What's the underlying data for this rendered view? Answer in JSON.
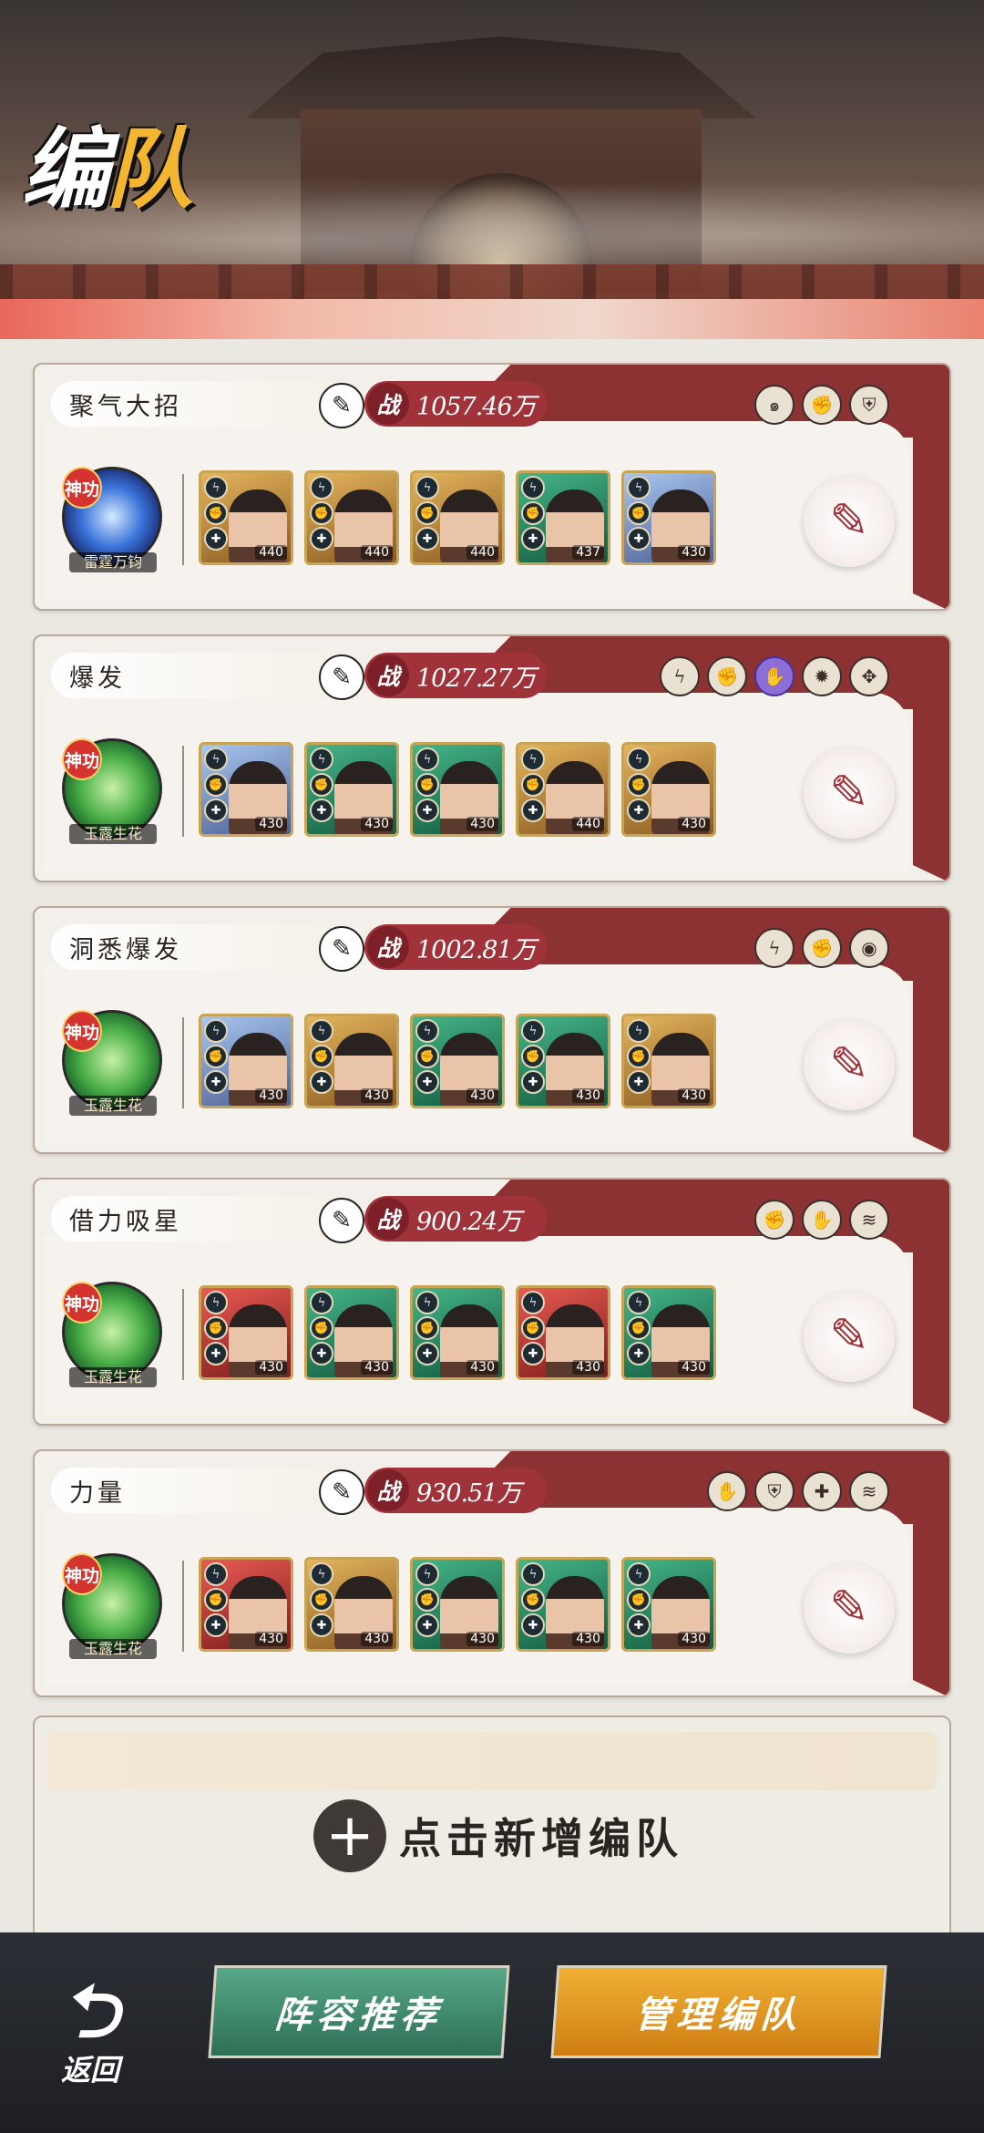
{
  "header": {
    "title_main": "编",
    "title_accent": "队"
  },
  "teams": [
    {
      "name": "聚气大招",
      "power": "1057.46万",
      "power_label": "战",
      "traits": [
        "swirl-icon",
        "fist-icon",
        "shield-icon"
      ],
      "skill": {
        "tag": "神功",
        "name": "雷霆万钧",
        "style": "thunder"
      },
      "heroes": [
        {
          "level": "440",
          "bg": "gold"
        },
        {
          "level": "440",
          "bg": "gold"
        },
        {
          "level": "440",
          "bg": "gold"
        },
        {
          "level": "437",
          "bg": "green"
        },
        {
          "level": "430",
          "bg": "blue"
        }
      ]
    },
    {
      "name": "爆发",
      "power": "1027.27万",
      "power_label": "战",
      "traits": [
        "lightning-icon",
        "fist-icon",
        "purple-hand-icon",
        "flame-icon",
        "paw-icon"
      ],
      "skill": {
        "tag": "神功",
        "name": "玉露生花",
        "style": "lotus"
      },
      "heroes": [
        {
          "level": "430",
          "bg": "blue"
        },
        {
          "level": "430",
          "bg": "green"
        },
        {
          "level": "430",
          "bg": "green"
        },
        {
          "level": "440",
          "bg": "gold"
        },
        {
          "level": "430",
          "bg": "gold"
        }
      ]
    },
    {
      "name": "洞悉爆发",
      "power": "1002.81万",
      "power_label": "战",
      "traits": [
        "lightning-icon",
        "fist-icon",
        "eye-icon"
      ],
      "skill": {
        "tag": "神功",
        "name": "玉露生花",
        "style": "lotus"
      },
      "heroes": [
        {
          "level": "430",
          "bg": "blue"
        },
        {
          "level": "430",
          "bg": "gold"
        },
        {
          "level": "430",
          "bg": "green"
        },
        {
          "level": "430",
          "bg": "green"
        },
        {
          "level": "430",
          "bg": "gold"
        }
      ]
    },
    {
      "name": "借力吸星",
      "power": "900.24万",
      "power_label": "战",
      "traits": [
        "fist-icon",
        "palm-icon",
        "claw-icon"
      ],
      "skill": {
        "tag": "神功",
        "name": "玉露生花",
        "style": "lotus"
      },
      "heroes": [
        {
          "level": "430",
          "bg": "red"
        },
        {
          "level": "430",
          "bg": "green"
        },
        {
          "level": "430",
          "bg": "green"
        },
        {
          "level": "430",
          "bg": "red"
        },
        {
          "level": "430",
          "bg": "green"
        }
      ]
    },
    {
      "name": "力量",
      "power": "930.51万",
      "power_label": "战",
      "traits": [
        "palm-icon",
        "shield-icon",
        "muscle-icon",
        "claw-icon"
      ],
      "skill": {
        "tag": "神功",
        "name": "玉露生花",
        "style": "lotus"
      },
      "heroes": [
        {
          "level": "430",
          "bg": "red"
        },
        {
          "level": "430",
          "bg": "gold"
        },
        {
          "level": "430",
          "bg": "green"
        },
        {
          "level": "430",
          "bg": "green"
        },
        {
          "level": "430",
          "bg": "green"
        }
      ]
    }
  ],
  "add_team": {
    "plus": "+",
    "label": "点击新增编队"
  },
  "bottom": {
    "back": "返回",
    "recommend": "阵容推荐",
    "manage": "管理编队"
  },
  "colors": {
    "banner": "#8c3233",
    "power": "#a0323a",
    "recommend": "#3e8a6c",
    "manage": "#e59a22"
  }
}
